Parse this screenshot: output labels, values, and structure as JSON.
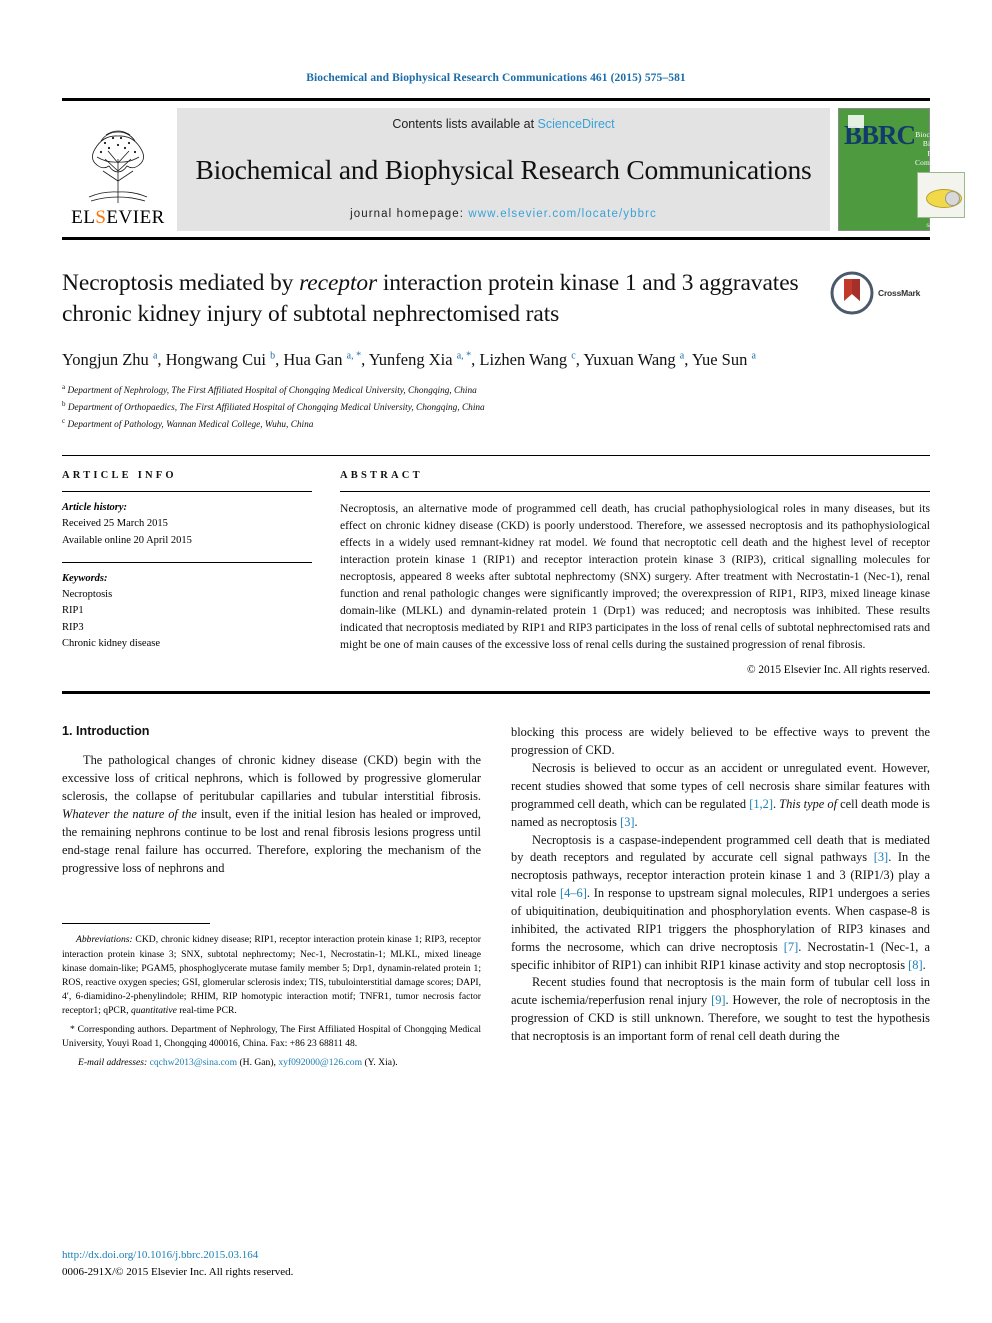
{
  "running_head": "Biochemical and Biophysical Research Communications 461 (2015) 575–581",
  "masthead": {
    "publisher": "ELSEVIER",
    "contents_prefix": "Contents lists available at ",
    "contents_link": "ScienceDirect",
    "journal_title": "Biochemical and Biophysical Research Communications",
    "homepage_label": "journal homepage: ",
    "homepage_url": "www.elsevier.com/locate/ybbrc",
    "cover": {
      "letters": "BBRC",
      "title": "Biochemical and Biophysical Research Communications",
      "footer": "ScienceDirect"
    }
  },
  "article": {
    "title_part1": "Necroptosis mediated by ",
    "title_italic": "receptor",
    "title_part2": " interaction protein kinase 1 and 3 aggravates chronic kidney injury of subtotal nephrectomised rats",
    "crossmark_label": "CrossMark",
    "authors": "Yongjun Zhu a, Hongwang Cui b, Hua Gan a, *, Yunfeng Xia a, *, Lizhen Wang c, Yuxuan Wang a, Yue Sun a",
    "affiliations": [
      {
        "marker": "a",
        "text": "Department of Nephrology, The First Affiliated Hospital of Chongqing Medical University, Chongqing, China"
      },
      {
        "marker": "b",
        "text": "Department of Orthopaedics, The First Affiliated Hospital of Chongqing Medical University, Chongqing, China"
      },
      {
        "marker": "c",
        "text": "Department of Pathology, Wannan Medical College, Wuhu, China"
      }
    ]
  },
  "article_info": {
    "heading": "ARTICLE INFO",
    "history_label": "Article history:",
    "history_lines": [
      "Received 25 March 2015",
      "Available online 20 April 2015"
    ],
    "keywords_label": "Keywords:",
    "keywords": [
      "Necroptosis",
      "RIP1",
      "RIP3",
      "Chronic kidney disease"
    ]
  },
  "abstract": {
    "heading": "ABSTRACT",
    "text_1": "Necroptosis, an alternative mode of programmed cell death, has crucial pathophysiological roles in many diseases, but its effect on chronic kidney disease (CKD) is poorly understood. Therefore, we assessed necroptosis and its pathophysiological effects in a widely used remnant-kidney rat model. ",
    "text_italic_1": "We",
    "text_2": " found that necroptotic cell death and the highest level of receptor interaction protein kinase 1 (RIP1) and receptor interaction protein kinase 3 (RIP3), critical signalling molecules for necroptosis, appeared 8 weeks after subtotal nephrectomy (SNX) surgery. After treatment with Necrostatin-1 (Nec-1), renal function and renal pathologic changes were significantly improved; the overexpression of RIP1, RIP3, mixed lineage kinase domain-like (MLKL) and dynamin-related protein 1 (Drp1) was reduced; and necroptosis was inhibited. These results indicated that necroptosis mediated by RIP1 and RIP3 participates in the loss of renal cells of subtotal nephrectomised rats and might be one of main causes of the excessive loss of renal cells during the sustained progression of renal fibrosis.",
    "copyright": "© 2015 Elsevier Inc. All rights reserved."
  },
  "introduction": {
    "heading": "1.  Introduction",
    "left_paragraph_1a": "The pathological changes of chronic kidney disease (CKD) begin with the excessive loss of critical nephrons, which is followed by progressive glomerular sclerosis, the collapse of peritubular capillaries and tubular interstitial fibrosis. ",
    "left_paragraph_1_italic": "Whatever the nature of the",
    "left_paragraph_1b": " insult, even if the initial lesion has healed or improved, the remaining nephrons continue to be lost and renal fibrosis lesions progress until end-stage renal failure has occurred. Therefore, exploring the mechanism of the progressive loss of nephrons and",
    "right_paragraph_1": "blocking this process are widely believed to be effective ways to prevent the progression of CKD.",
    "right_paragraph_2a": "Necrosis is believed to occur as an accident or unregulated event. However, recent studies showed that some types of cell necrosis share similar features with programmed cell death, which can be regulated ",
    "right_p2_ref1": "[1,2]",
    "right_paragraph_2b": ". ",
    "right_p2_italic": "This type of",
    "right_paragraph_2c": " cell death mode is named as necroptosis ",
    "right_p2_ref2": "[3]",
    "right_paragraph_2d": ".",
    "right_paragraph_3a": "Necroptosis is a caspase-independent programmed cell death that is mediated by death receptors and regulated by accurate cell signal pathways ",
    "right_p3_ref1": "[3]",
    "right_paragraph_3b": ". In the necroptosis pathways, receptor interaction protein kinase 1 and 3 (RIP1/3) play a vital role ",
    "right_p3_ref2": "[4–6]",
    "right_paragraph_3c": ". In response to upstream signal molecules, RIP1 undergoes a series of ubiquitination, deubiquitination and phosphorylation events. When caspase-8 is inhibited, the activated RIP1 triggers the phosphorylation of RIP3 kinases and forms the necrosome, which can drive necroptosis ",
    "right_p3_ref3": "[7]",
    "right_paragraph_3d": ". Necrostatin-1 (Nec-1, a specific inhibitor of RIP1) can inhibit RIP1 kinase activity and stop necroptosis ",
    "right_p3_ref4": "[8]",
    "right_paragraph_3e": ".",
    "right_paragraph_4a": "Recent studies found that necroptosis is the main form of tubular cell loss in acute ischemia/reperfusion renal injury ",
    "right_p4_ref1": "[9]",
    "right_paragraph_4b": ". However, the role of necroptosis in the progression of CKD is still unknown. Therefore, we sought to test the hypothesis that necroptosis is an important form of renal cell death during the"
  },
  "footnotes": {
    "abbr_label": "Abbreviations:",
    "abbr_text_1": " CKD, chronic kidney disease; RIP1, receptor interaction protein kinase 1; RIP3, receptor interaction protein kinase 3; SNX, subtotal nephrectomy; Nec-1, Necrostatin-1; MLKL, mixed lineage kinase domain-like; PGAM5, phosphoglycerate mutase family member 5; Drp1, dynamin-related protein 1; ROS, reactive oxygen species; GSI, glomerular sclerosis index; TIS, tubulointerstitial damage scores; DAPI, 4′, 6-diamidino-2-phenylindole; RHIM, RIP homotypic interaction motif; TNFR1, tumor necrosis factor receptor1; qPCR, ",
    "abbr_italic": "quantitative",
    "abbr_text_2": " real-time PCR.",
    "corresponding": "* Corresponding authors. Department of Nephrology, The First Affiliated Hospital of Chongqing Medical University, Youyi Road 1, Chongqing 400016, China. Fax: +86 23 68811 48.",
    "email_label": "E-mail addresses:",
    "email_1": "cqchw2013@sina.com",
    "email_1_owner": " (H. Gan), ",
    "email_2": "xyf092000@126.com",
    "email_2_owner": " (Y. Xia)."
  },
  "footer": {
    "doi": "http://dx.doi.org/10.1016/j.bbrc.2015.03.164",
    "issn_line": "0006-291X/© 2015 Elsevier Inc. All rights reserved."
  },
  "colors": {
    "link": "#1b7fb5",
    "running_head": "#1b6ca8",
    "sciencedirect": "#3aa2d9",
    "cover_green": "#4e9a3e",
    "elsevier_orange": "#ff7300"
  }
}
